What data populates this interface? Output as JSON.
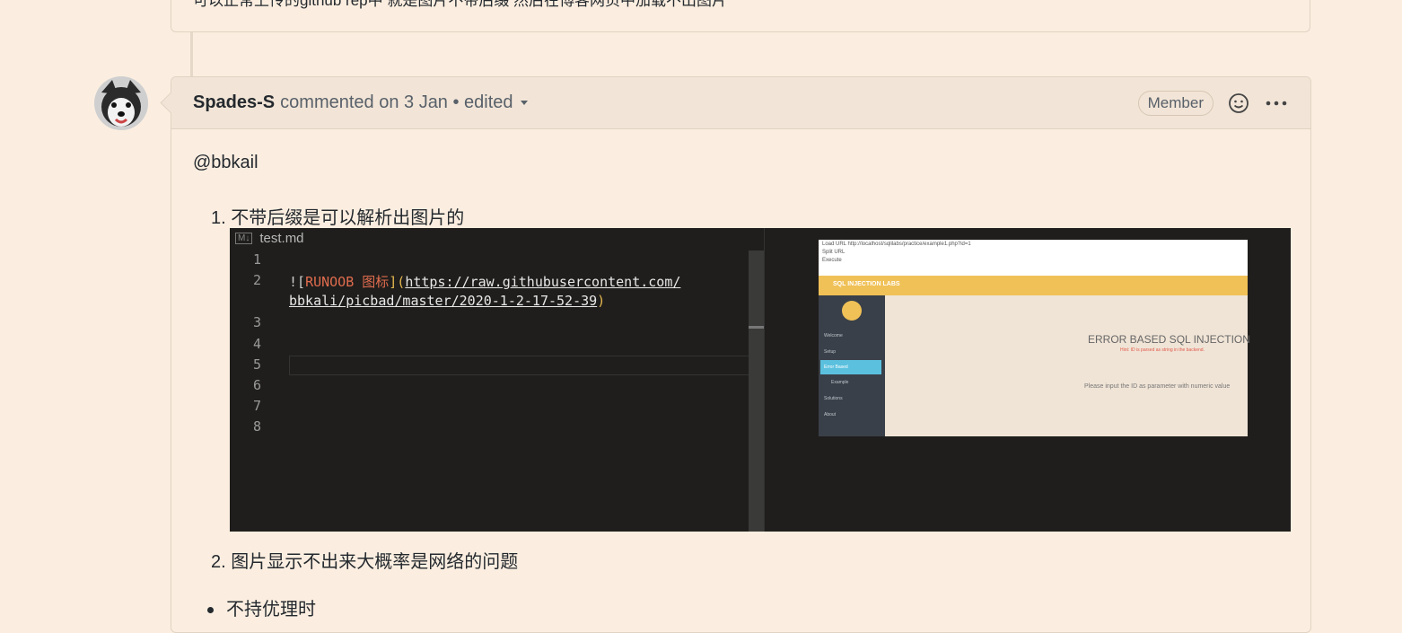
{
  "previous_comment": {
    "text": "可以正常上传的github rep中 就是图片不带后缀 然后在博客网页中加载不出图片"
  },
  "comment": {
    "author": "Spades-S",
    "meta": "commented on 3 Jan • edited",
    "badge": "Member",
    "mention": "@bbkail",
    "list": [
      "1. 不带后缀是可以解析出图片的",
      "2. 图片显示不出来大概率是网络的问题"
    ],
    "bullet": "不持优理时"
  },
  "screenshot": {
    "tab": "test.md",
    "tab_icon": "M↓",
    "line_numbers": [
      "1",
      "2",
      "3",
      "4",
      "5",
      "6",
      "7",
      "8"
    ],
    "code_prefix": "![",
    "code_alt": "RUNOOB 图标",
    "code_mid": "](",
    "code_url_1": "https://raw.githubusercontent.com/",
    "code_url_2": "bbkali/picbad/master/2020-1-2-17-52-39",
    "code_suffix": ")",
    "preview": {
      "top_rows": [
        "Load URL  http://localhost/sqlilabs/practice/example1.php?id=1",
        "Split URL",
        "Execute"
      ],
      "bar": "SQL INJECTION LABS",
      "nav": [
        "Welcome",
        "Setup",
        "Error Based",
        "Example",
        "Solutions",
        "About"
      ],
      "title": "ERROR BASED SQL INJECTION",
      "subtitle": "Hint: ID is parsed as string in the backend.",
      "note": "Please input the ID as parameter with numeric value"
    }
  },
  "colors": {
    "page_bg": "#fbeee0",
    "header_bg": "#f2e5d7",
    "border": "#e1d3c3"
  },
  "icons": [
    "smiley-icon",
    "kebab-menu-icon",
    "caret-down-icon"
  ]
}
